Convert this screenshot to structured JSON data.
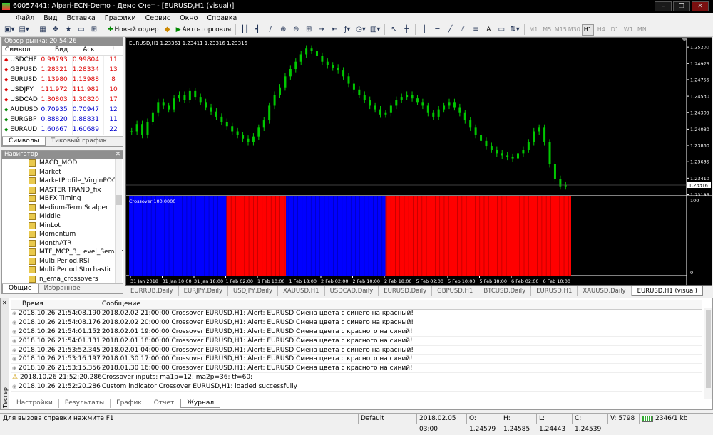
{
  "window": {
    "title": "60057441: Alpari-ECN-Demo - Демо Счет - [EURUSD,H1 (visual)]",
    "controls": [
      "–",
      "❐",
      "✕"
    ]
  },
  "menu": [
    "Файл",
    "Вид",
    "Вставка",
    "Графики",
    "Сервис",
    "Окно",
    "Справка"
  ],
  "toolbar": {
    "new_order": "Новый ордер",
    "autotrade": "Авто-торговля",
    "text_tool": "A",
    "timeframes": [
      "M1",
      "M5",
      "M15",
      "M30",
      "H1",
      "H4",
      "D1",
      "W1",
      "MN"
    ],
    "active_tf": "H1"
  },
  "market_watch": {
    "header": "Обзор рынка: 20:54:26",
    "columns": [
      "Символ",
      "Бид",
      "Аск",
      "!"
    ],
    "rows": [
      {
        "symbol": "USDCHF",
        "bid": "0.99793",
        "ask": "0.99804",
        "spread": "11",
        "dir": "down"
      },
      {
        "symbol": "GBPUSD",
        "bid": "1.28321",
        "ask": "1.28334",
        "spread": "13",
        "dir": "down"
      },
      {
        "symbol": "EURUSD",
        "bid": "1.13980",
        "ask": "1.13988",
        "spread": "8",
        "dir": "down"
      },
      {
        "symbol": "USDJPY",
        "bid": "111.972",
        "ask": "111.982",
        "spread": "10",
        "dir": "down"
      },
      {
        "symbol": "USDCAD",
        "bid": "1.30803",
        "ask": "1.30820",
        "spread": "17",
        "dir": "down"
      },
      {
        "symbol": "AUDUSD",
        "bid": "0.70935",
        "ask": "0.70947",
        "spread": "12",
        "dir": "up"
      },
      {
        "symbol": "EURGBP",
        "bid": "0.88820",
        "ask": "0.88831",
        "spread": "11",
        "dir": "up"
      },
      {
        "symbol": "EURAUD",
        "bid": "1.60667",
        "ask": "1.60689",
        "spread": "22",
        "dir": "up"
      }
    ],
    "tabs": [
      "Символы",
      "Тиковый график"
    ]
  },
  "navigator": {
    "header": "Навигатор",
    "items": [
      "MACD_MOD",
      "Market",
      "MarketProfile_VirginPOC",
      "MASTER TRAND_fix",
      "MBFX Timing",
      "Medium-Term Scalper",
      "Middle",
      "MinLot",
      "Momentum",
      "MonthATR",
      "MTF_MCP_3_Level_Semafor_",
      "Multi.Period.RSI",
      "Multi.Period.Stochastic",
      "n_ema_crossovers"
    ],
    "tabs": [
      "Общие",
      "Избранное"
    ]
  },
  "chart": {
    "ohlc_label": "EURUSD,H1  1.23361 1.23411 1.23316 1.23316",
    "current_price": "1.23316",
    "price_ticks": [
      "1.25200",
      "1.24975",
      "1.24755",
      "1.24530",
      "1.24305",
      "1.24080",
      "1.23860",
      "1.23635",
      "1.23410",
      "1.23185"
    ],
    "indicator_label": "Crossover 100.0000",
    "indicator_ticks": [
      "100",
      "0"
    ],
    "time_ticks": [
      "31 Jan 2018",
      "31 Jan 10:00",
      "31 Jan 18:00",
      "1 Feb 02:00",
      "1 Feb 10:00",
      "1 Feb 18:00",
      "2 Feb 02:00",
      "2 Feb 10:00",
      "2 Feb 18:00",
      "5 Feb 02:00",
      "5 Feb 10:00",
      "5 Feb 18:00",
      "6 Feb 02:00",
      "6 Feb 10:00"
    ],
    "tabs": [
      "EURRUB,Daily",
      "EURJPY,Daily",
      "USDJPY,Daily",
      "XAUUSD,H1",
      "USDCAD,Daily",
      "EURUSD,Daily",
      "GBPUSD,H1",
      "BTCUSD,Daily",
      "EURUSD,H1",
      "XAUUSD,Daily",
      "EURUSD,H1 (visual)"
    ],
    "active_tab": 10,
    "colors": {
      "bull": "#00cc00",
      "bear": "#00cc00",
      "ind_blue": "#0000ff",
      "ind_red": "#ff0000"
    }
  },
  "chart_data": {
    "type": "line",
    "title": "EURUSD,H1",
    "close": [
      1.2405,
      1.2415,
      1.24,
      1.2418,
      1.243,
      1.2445,
      1.244,
      1.2435,
      1.245,
      1.2455,
      1.2448,
      1.246,
      1.2452,
      1.2445,
      1.2438,
      1.2432,
      1.2425,
      1.2418,
      1.2412,
      1.2405,
      1.24,
      1.2395,
      1.239,
      1.2398,
      1.241,
      1.242,
      1.244,
      1.2455,
      1.2465,
      1.248,
      1.249,
      1.25,
      1.251,
      1.2518,
      1.2515,
      1.2508,
      1.25,
      1.2495,
      1.2492,
      1.2488,
      1.248,
      1.247,
      1.2462,
      1.2455,
      1.2448,
      1.244,
      1.2435,
      1.2428,
      1.243,
      1.244,
      1.2448,
      1.2452,
      1.2455,
      1.245,
      1.2445,
      1.244,
      1.243,
      1.2425,
      1.2435,
      1.244,
      1.2445,
      1.2438,
      1.243,
      1.242,
      1.241,
      1.24,
      1.2392,
      1.2385,
      1.238,
      1.2375,
      1.2372,
      1.237,
      1.2368,
      1.2375,
      1.238,
      1.239,
      1.2405,
      1.241,
      1.239,
      1.236,
      1.234,
      1.233,
      1.2332
    ],
    "crossover_signal": "blue→red at 1 Feb 02:00, red→blue at 1 Feb 10:00, blue→red at 2 Feb 02:00",
    "ylim": [
      1.2318,
      1.2525
    ],
    "indicator_ylim": [
      0,
      100
    ]
  },
  "terminal": {
    "columns": [
      "Время",
      "Сообщение"
    ],
    "rows": [
      {
        "icon": "info",
        "time": "2018.10.26 21:54:08.190",
        "msg": "2018.02.02 21:00:00  Crossover EURUSD,H1: Alert: EURUSD Смена цвета с синего на красный!"
      },
      {
        "icon": "info",
        "time": "2018.10.26 21:54:08.176",
        "msg": "2018.02.02 20:00:00  Crossover EURUSD,H1: Alert: EURUSD Смена цвета с синего на красный!"
      },
      {
        "icon": "info",
        "time": "2018.10.26 21:54:01.152",
        "msg": "2018.02.01 19:00:00  Crossover EURUSD,H1: Alert: EURUSD Смена цвета с красного на синий!"
      },
      {
        "icon": "info",
        "time": "2018.10.26 21:54:01.131",
        "msg": "2018.02.01 18:00:00  Crossover EURUSD,H1: Alert: EURUSD Смена цвета с красного на синий!"
      },
      {
        "icon": "info",
        "time": "2018.10.26 21:53:52.345",
        "msg": "2018.02.01 04:00:00  Crossover EURUSD,H1: Alert: EURUSD Смена цвета с синего на красный!"
      },
      {
        "icon": "info",
        "time": "2018.10.26 21:53:16.197",
        "msg": "2018.01.30 17:00:00  Crossover EURUSD,H1: Alert: EURUSD Смена цвета с красного на синий!"
      },
      {
        "icon": "info",
        "time": "2018.10.26 21:53:15.356",
        "msg": "2018.01.30 16:00:00  Crossover EURUSD,H1: Alert: EURUSD Смена цвета с красного на синий!"
      },
      {
        "icon": "warn",
        "time": "2018.10.26 21:52:20.286",
        "msg": "Crossover inputs: ma1p=12; ma2p=36; tf=60;"
      },
      {
        "icon": "info",
        "time": "2018.10.26 21:52:20.286",
        "msg": "Custom indicator Crossover EURUSD,H1: loaded successfully"
      }
    ],
    "side_label": "Тестер",
    "tabs": [
      "Настройки",
      "Результаты",
      "График",
      "Отчет",
      "Журнал"
    ],
    "active_tab": 4
  },
  "status": {
    "help": "Для вызова справки нажмите F1",
    "profile": "Default",
    "datetime": "2018.02.05 03:00",
    "open": "O: 1.24579",
    "high": "H: 1.24585",
    "low": "L: 1.24443",
    "close": "C: 1.24539",
    "volume": "V: 5798",
    "traffic": "2346/1 kb"
  }
}
